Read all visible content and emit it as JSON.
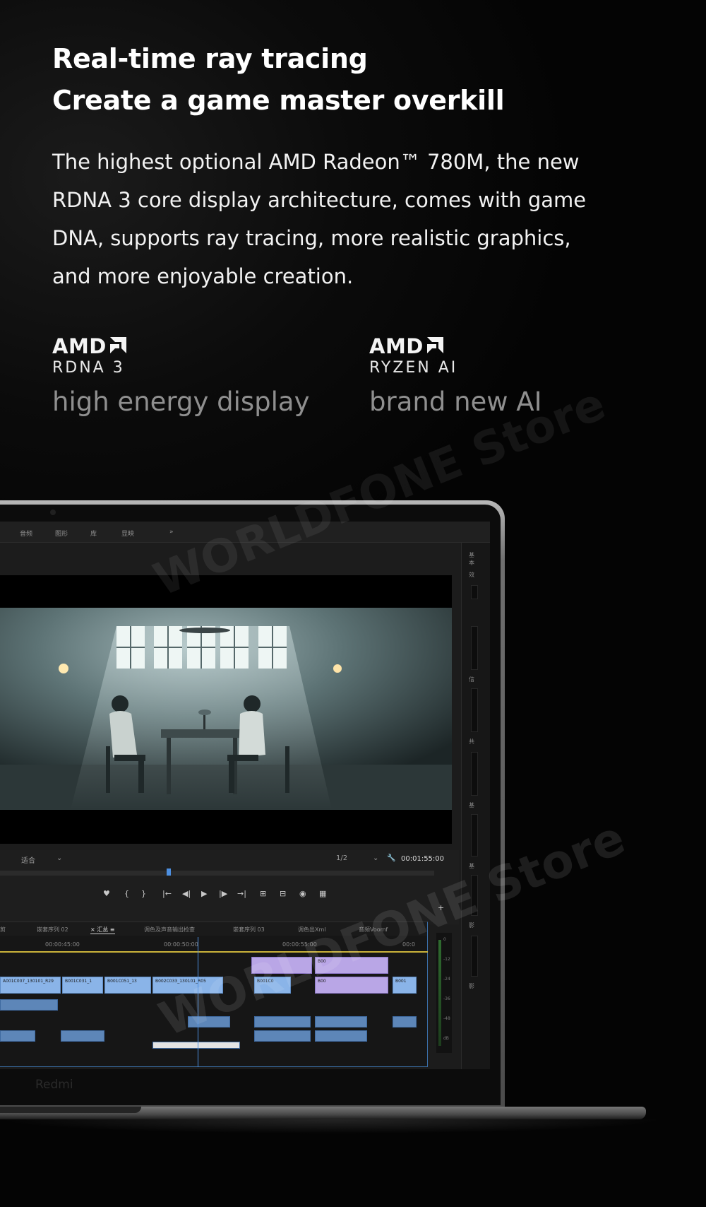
{
  "headline": {
    "line1": "Real-time ray tracing",
    "line2": "Create a game master overkill"
  },
  "description": {
    "line1": "The highest optional AMD Radeon™ 780M, the new",
    "line2": "RDNA 3 core display architecture, comes with game",
    "line3": "DNA, supports ray tracing, more realistic graphics,",
    "line4": "and more enjoyable creation."
  },
  "features": [
    {
      "logo_word": "AMD",
      "logo_sub": "RDNA 3",
      "caption": "high energy display"
    },
    {
      "logo_word": "AMD",
      "logo_sub": "RYZEN AI",
      "caption": "brand new AI"
    }
  ],
  "watermarks": [
    "WORLDFONE Store",
    "WORLDFONE Store"
  ],
  "laptop": {
    "brand": "Redmi"
  },
  "editor": {
    "menu": [
      "音频",
      "图形",
      "库",
      "显映",
      "»"
    ],
    "side_labels": [
      "基本",
      "效",
      "信",
      "共",
      "基",
      "基",
      "影",
      "影"
    ],
    "fit_select": "适合",
    "resolution_select": "1/2",
    "timecode": "00:01:55:00",
    "transport": [
      "♥",
      "{",
      "}",
      "|←",
      "◀|",
      "▶",
      "|▶",
      "→|",
      "⊞",
      "⊟",
      "◉",
      "▦"
    ],
    "tabs": [
      "剪",
      "嵌套序列 02",
      "× 汇总 ≡",
      "调色及声音输出检查",
      "嵌套序列 03",
      "调色出Xml",
      "音频Voomf"
    ],
    "ruler": [
      "00:00:45:00",
      "00:00:50:00",
      "00:00:55:00",
      "00:0"
    ],
    "clip_names": [
      "A001C007_130101_R29",
      "B001C031_1",
      "B001C051_13",
      "B002C033_130101_R05",
      "B001C0",
      "B00",
      "B00",
      "B001"
    ],
    "meter_labels": [
      "0",
      "-12",
      "-24",
      "-36",
      "-48",
      "dB"
    ]
  },
  "colors": {
    "background": "#000000",
    "headline": "#ffffff",
    "caption": "#8f8f8f",
    "timeline_accent": "#4d8fe0"
  }
}
